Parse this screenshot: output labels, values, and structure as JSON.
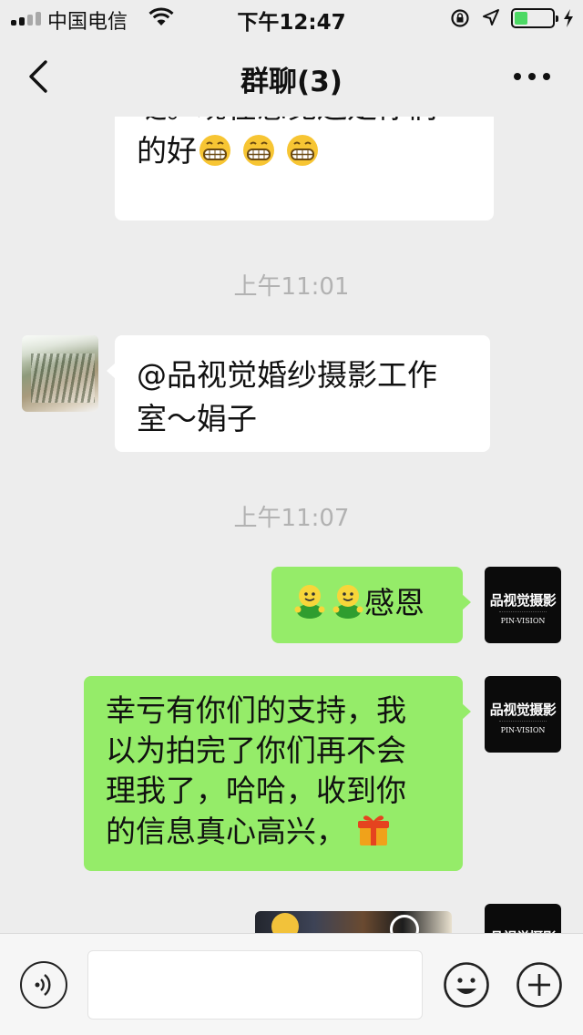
{
  "status_bar": {
    "carrier": "中国电信",
    "time": "下午12:47",
    "battery_level": 0.35,
    "signal_bars_active": 2,
    "signal_bars_total": 4
  },
  "nav": {
    "title": "群聊(3)",
    "back_icon": "chevron-left-icon",
    "more_icon": "more-dots-icon"
  },
  "messages": [
    {
      "direction": "in",
      "text_line1": "哒。现在感觉还是你们",
      "text_line2": "的好",
      "emoji": [
        "grin-emoji",
        "grin-emoji",
        "grin-emoji"
      ]
    },
    {
      "timestamp": "上午11:01"
    },
    {
      "direction": "in",
      "text_line1": "@品视觉婚纱摄影工作",
      "text_line2": "室～娟子"
    },
    {
      "timestamp": "上午11:07"
    },
    {
      "direction": "out",
      "emoji": [
        "smiley-figure-emoji",
        "smiley-figure-emoji"
      ],
      "text": "感恩"
    },
    {
      "direction": "out",
      "lines": [
        "幸亏有你们的支持，我",
        "以为拍完了你们再不会",
        "理我了，哈哈，收到你",
        "的信息真心高兴，"
      ],
      "emoji": [
        "gift-emoji"
      ]
    },
    {
      "direction": "out",
      "type": "image"
    }
  ],
  "avatar_brand": {
    "title": "品视觉摄影",
    "subtitle": "PIN-VISION"
  },
  "input_bar": {
    "placeholder": "",
    "voice_icon": "voice-icon",
    "emoji_icon": "emoji-icon",
    "plus_icon": "plus-icon"
  },
  "colors": {
    "background": "#ededed",
    "bubble_out": "#95ec69",
    "bubble_in": "#ffffff",
    "timestamp": "#b2b2b2",
    "battery": "#4cd964"
  }
}
